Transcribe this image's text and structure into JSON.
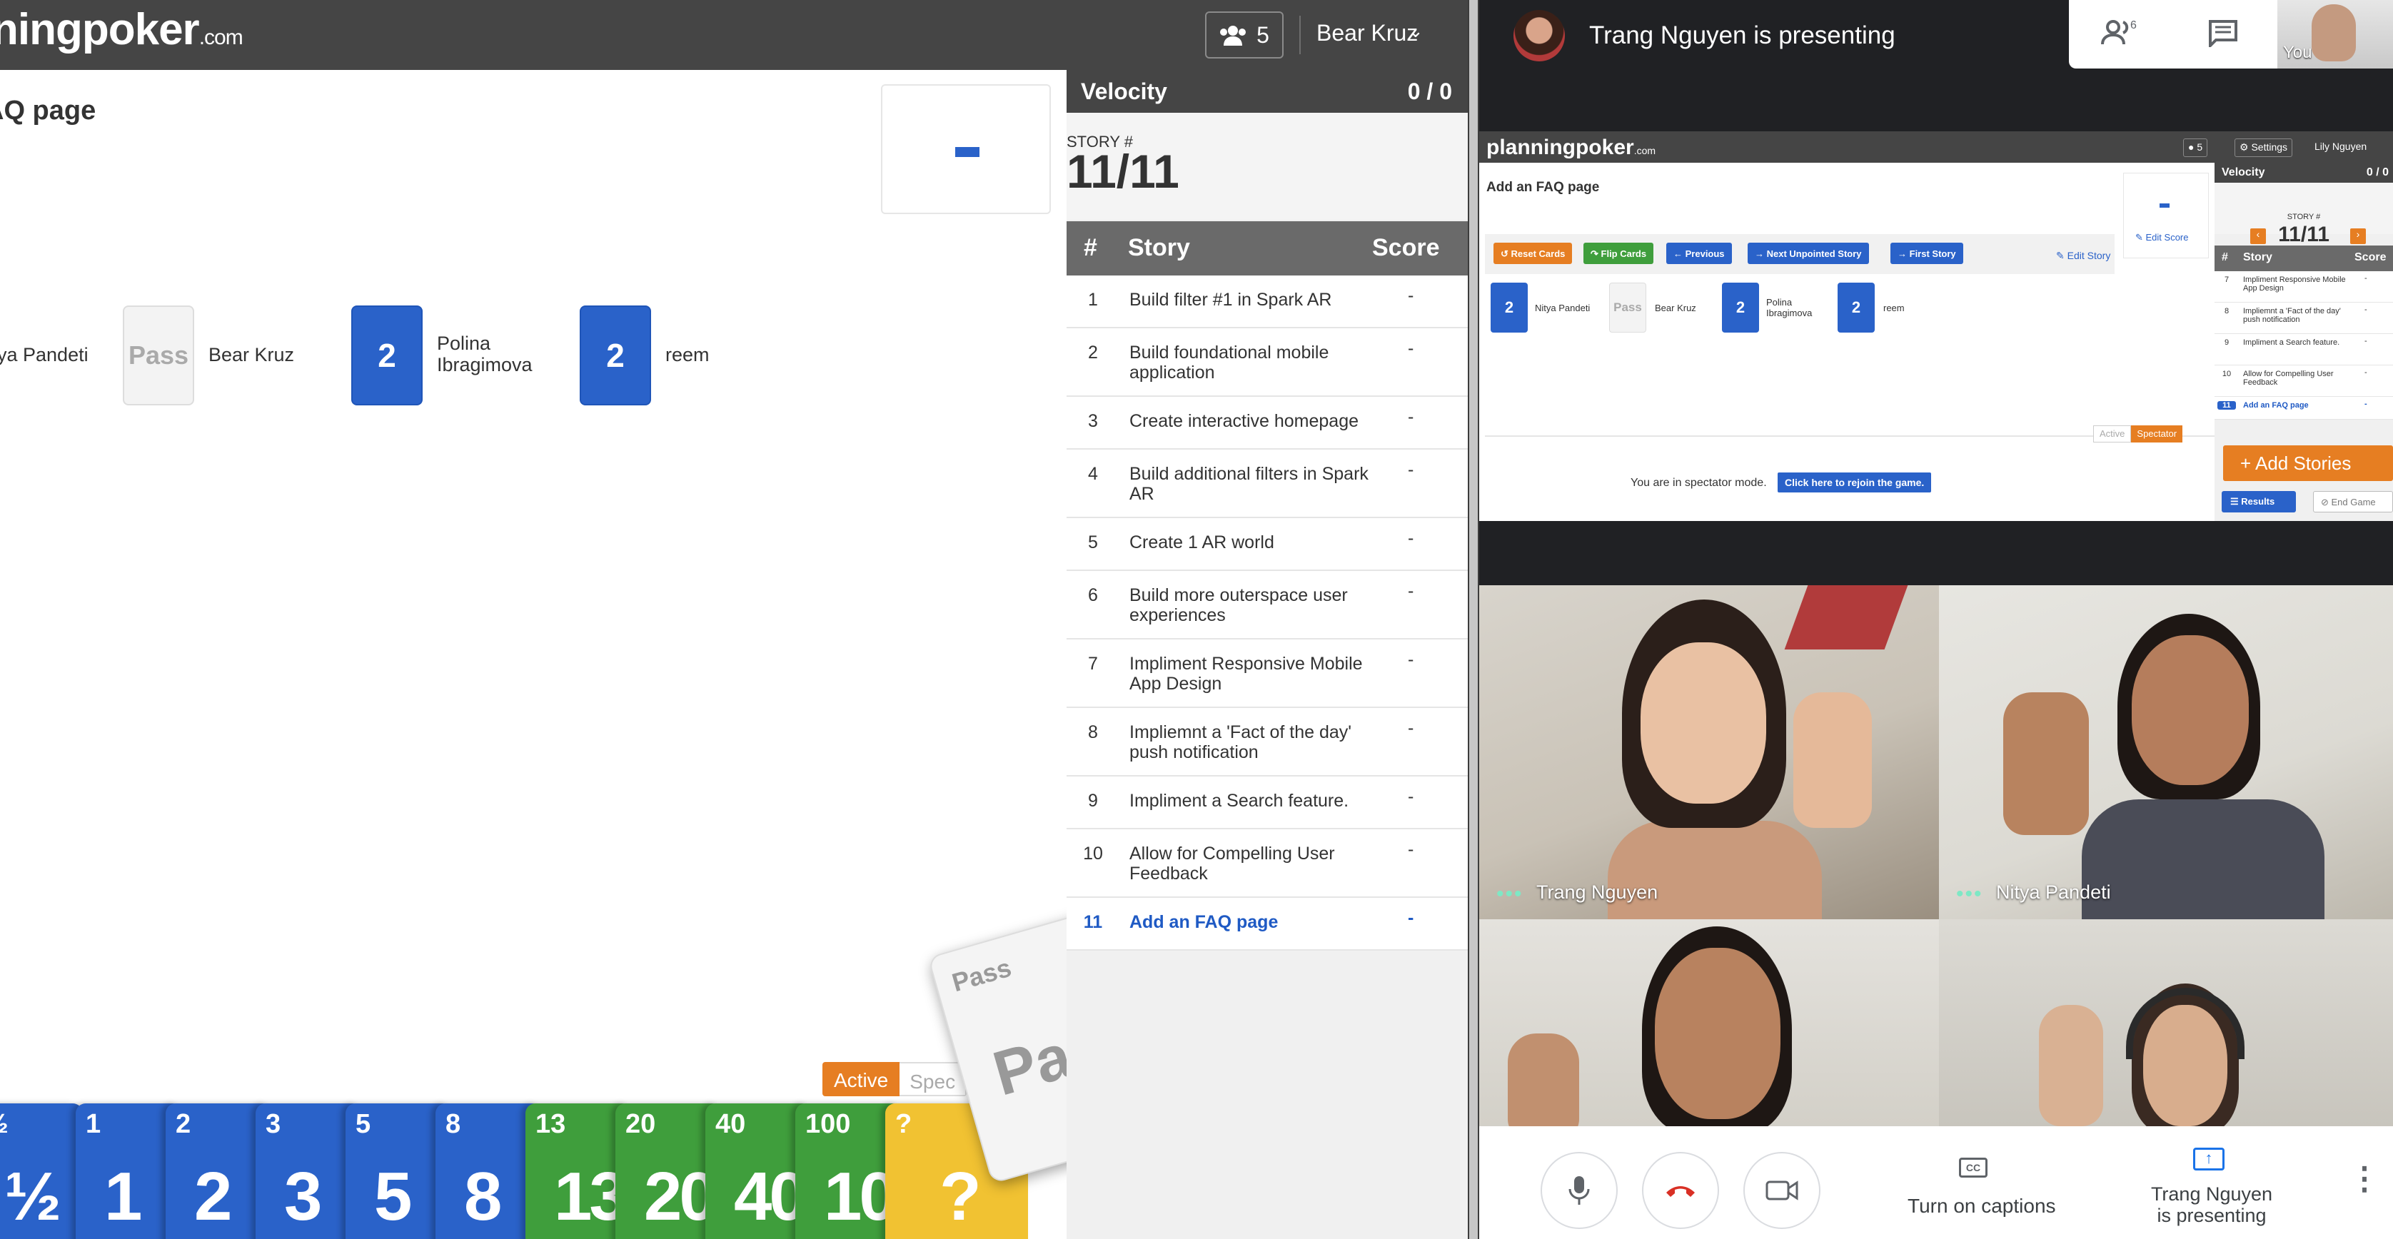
{
  "planningpoker": {
    "logo_text": "ningpoker",
    "logo_suffix": ".com",
    "players_count": "5",
    "user_name": "Bear Kruz",
    "story_title": "AQ page",
    "score_display": "-",
    "players": [
      {
        "name": "ya Pandeti",
        "card": ""
      },
      {
        "name": "Bear Kruz",
        "card": "Pass"
      },
      {
        "name": "Polina Ibragimova",
        "card": "2"
      },
      {
        "name": "reem",
        "card": "2"
      }
    ],
    "mode_toggle": {
      "active": "Active",
      "spectator": "Spec"
    },
    "deck": [
      {
        "small": "½",
        "big": "½",
        "color": "blue"
      },
      {
        "small": "1",
        "big": "1",
        "color": "blue"
      },
      {
        "small": "2",
        "big": "2",
        "color": "blue"
      },
      {
        "small": "3",
        "big": "3",
        "color": "blue"
      },
      {
        "small": "5",
        "big": "5",
        "color": "blue"
      },
      {
        "small": "8",
        "big": "8",
        "color": "blue"
      },
      {
        "small": "13",
        "big": "13",
        "color": "green"
      },
      {
        "small": "20",
        "big": "20",
        "color": "green"
      },
      {
        "small": "40",
        "big": "40",
        "color": "green"
      },
      {
        "small": "100",
        "big": "10",
        "color": "green"
      },
      {
        "small": "?",
        "big": "?",
        "color": "yellow"
      }
    ],
    "floating_card": {
      "small": "Pass",
      "big": "Pas"
    },
    "sidebar": {
      "velocity_label": "Velocity",
      "velocity_value": "0 / 0",
      "story_num_label": "STORY #",
      "story_num_value": "11/11",
      "table_headers": {
        "num": "#",
        "story": "Story",
        "score": "Score"
      },
      "stories": [
        {
          "num": "1",
          "title": "Build filter #1 in Spark AR",
          "score": "-"
        },
        {
          "num": "2",
          "title": "Build foundational mobile application",
          "score": "-"
        },
        {
          "num": "3",
          "title": "Create interactive homepage",
          "score": "-"
        },
        {
          "num": "4",
          "title": "Build additional filters in Spark AR",
          "score": "-"
        },
        {
          "num": "5",
          "title": "Create 1 AR world",
          "score": "-"
        },
        {
          "num": "6",
          "title": "Build more outerspace user experiences",
          "score": "-"
        },
        {
          "num": "7",
          "title": "Impliment Responsive Mobile App Design",
          "score": "-"
        },
        {
          "num": "8",
          "title": "Impliemnt a 'Fact of the day' push notification",
          "score": "-"
        },
        {
          "num": "9",
          "title": "Impliment a Search feature.",
          "score": "-"
        },
        {
          "num": "10",
          "title": "Allow for Compelling User Feedback",
          "score": "-"
        },
        {
          "num": "11",
          "title": "Add an FAQ page",
          "score": "-"
        }
      ]
    }
  },
  "meet": {
    "presenting_banner": "Trang Nguyen is presenting",
    "people_count": "6",
    "self_label": "You",
    "shared_screen": {
      "logo_text": "planningpoker",
      "logo_suffix": ".com",
      "players_count": "5",
      "settings_label": "Settings",
      "user_name": "Lily Nguyen",
      "story_title": "Add an FAQ page",
      "buttons": [
        "Reset Cards",
        "Flip Cards",
        "Previous",
        "Next Unpointed Story",
        "First Story"
      ],
      "edit_story": "Edit Story",
      "edit_score": "Edit Score",
      "score_display": "-",
      "players": [
        {
          "name": "Nitya Pandeti",
          "card": "2"
        },
        {
          "name": "Bear Kruz",
          "card": "Pass"
        },
        {
          "name": "Polina Ibragimova",
          "card": "2"
        },
        {
          "name": "reem",
          "card": "2"
        }
      ],
      "toggle_active": "Active",
      "toggle_spectator": "Spectator",
      "spectator_message": "You are in spectator mode.",
      "rejoin_label": "Click here to rejoin the game.",
      "velocity_label": "Velocity",
      "velocity_value": "0 / 0",
      "story_num_label": "STORY #",
      "story_num_value": "11/11",
      "table_headers": {
        "num": "#",
        "story": "Story",
        "score": "Score"
      },
      "stories": [
        {
          "num": "7",
          "title": "Impliment Responsive Mobile App Design",
          "score": "-"
        },
        {
          "num": "8",
          "title": "Impliemnt a 'Fact of the day' push notification",
          "score": "-"
        },
        {
          "num": "9",
          "title": "Impliment a Search feature.",
          "score": "-"
        },
        {
          "num": "10",
          "title": "Allow for Compelling User Feedback",
          "score": "-"
        },
        {
          "num": "11",
          "title": "Add an FAQ page",
          "score": "-"
        }
      ],
      "add_stories": "+ Add Stories",
      "results": "Results",
      "end_game": "End Game"
    },
    "participants": [
      {
        "name": "Trang Nguyen"
      },
      {
        "name": "Nitya Pandeti"
      },
      {
        "name": ""
      },
      {
        "name": ""
      }
    ],
    "controls": {
      "captions_label": "Turn on captions",
      "presenting_label": "Trang Nguyen is presenting"
    }
  }
}
